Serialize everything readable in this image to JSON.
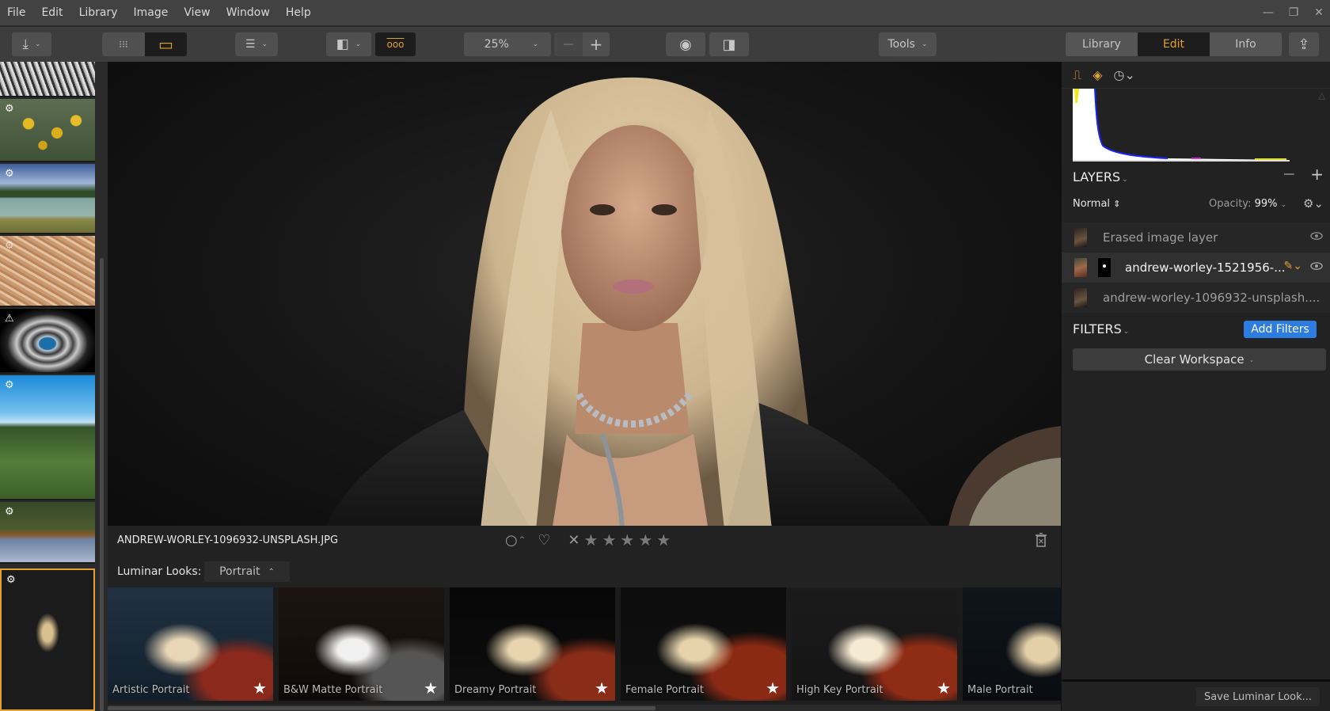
{
  "menu": [
    "File",
    "Edit",
    "Library",
    "Image",
    "View",
    "Window",
    "Help"
  ],
  "window_controls": {
    "minimize": "—",
    "restore": "❐",
    "close": "✕"
  },
  "toolbar": {
    "import_icon": "⤓",
    "grid_icon": "⁝⁝⁝",
    "single_view_icon": "▭",
    "sort_icon": "☰",
    "sidebar_icon": "◧",
    "filmstrip_icon": "ooo",
    "zoom_value": "25%",
    "zoom_minus": "—",
    "zoom_plus": "+",
    "preview_icon": "◉",
    "compare_icon": "◨",
    "tools_label": "Tools",
    "mode_tabs": [
      {
        "label": "Library",
        "active": false
      },
      {
        "label": "Edit",
        "active": true
      },
      {
        "label": "Info",
        "active": false
      }
    ],
    "share_icon": "⇪",
    "chevron": "⌄"
  },
  "filmstrip": [
    {
      "name": "snowy-trees",
      "badge": ""
    },
    {
      "name": "yellow-flowers",
      "badge": "⚙"
    },
    {
      "name": "lake-landscape",
      "badge": "⚙"
    },
    {
      "name": "dry-grass",
      "badge": "⚙"
    },
    {
      "name": "water-drop",
      "badge": "⚠"
    },
    {
      "name": "forest-sky",
      "badge": "⚙"
    },
    {
      "name": "sailboat",
      "badge": "⚙"
    },
    {
      "name": "portrait-selected",
      "badge": "⚙",
      "selected": true
    }
  ],
  "viewer": {
    "filename": "ANDREW-WORLEY-1096932-UNSPLASH.JPG",
    "color_label_icon": "○",
    "favorite_icon": "♡",
    "reject_icon": "✕",
    "stars": [
      "★",
      "★",
      "★",
      "★",
      "★"
    ],
    "rating": 0,
    "trash_icon": "🗑"
  },
  "looks": {
    "label": "Luminar Looks:",
    "category": "Portrait",
    "category_chevron": "⌃",
    "items": [
      {
        "name": "Artistic Portrait",
        "favorite": true
      },
      {
        "name": "B&W Matte Portrait",
        "favorite": true
      },
      {
        "name": "Dreamy Portrait",
        "favorite": true
      },
      {
        "name": "Female Portrait",
        "favorite": true
      },
      {
        "name": "High Key Portrait",
        "favorite": true
      },
      {
        "name": "Male Portrait",
        "favorite": false
      }
    ],
    "star_icon": "★",
    "save_label": "Save Luminar Look..."
  },
  "right_panel": {
    "tab_icons": {
      "histogram": "⎍",
      "layers": "◈",
      "history": "◷⌄"
    },
    "layers_title": "LAYERS",
    "remove_layer": "—",
    "add_layer": "+",
    "blend_mode": "Normal",
    "blend_icon": "⇕",
    "opacity_label": "Opacity:",
    "opacity_value": "99%",
    "gear_icon": "⚙⌄",
    "layers": [
      {
        "name": "Erased image layer",
        "active": false,
        "has_mask": false
      },
      {
        "name": "andrew-worley-1521956-...",
        "active": true,
        "has_mask": true
      },
      {
        "name": "andrew-worley-1096932-unsplash....",
        "active": false,
        "has_mask": false
      }
    ],
    "eye_icon": "👁",
    "brush_icon": "✎⌄",
    "filters_title": "FILTERS",
    "add_filters_label": "Add Filters",
    "clear_workspace_label": "Clear Workspace",
    "chevron": "⌄",
    "accent_color": "#e1a134",
    "button_blue": "#2d7de0"
  }
}
